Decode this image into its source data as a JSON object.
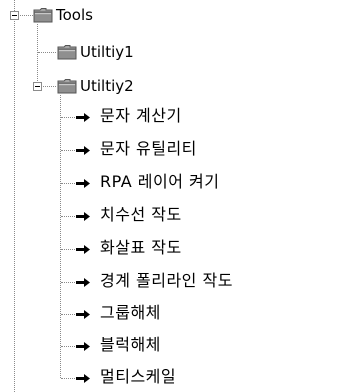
{
  "tree": {
    "root": {
      "label": "Tools",
      "icon": "folder-icon",
      "expanded": true,
      "children": [
        {
          "label": "Utiltiy1",
          "icon": "folder-icon",
          "expanded": false
        },
        {
          "label": "Utiltiy2",
          "icon": "folder-icon",
          "expanded": true,
          "items": [
            {
              "label": "문자 계산기",
              "icon": "arrow-right-icon"
            },
            {
              "label": "문자 유틸리티",
              "icon": "arrow-right-icon"
            },
            {
              "label": "RPA 레이어 켜기",
              "icon": "arrow-right-icon"
            },
            {
              "label": "치수선 작도",
              "icon": "arrow-right-icon"
            },
            {
              "label": "화살표 작도",
              "icon": "arrow-right-icon"
            },
            {
              "label": "경계 폴리라인 작도",
              "icon": "arrow-right-icon"
            },
            {
              "label": "그룹해체",
              "icon": "arrow-right-icon"
            },
            {
              "label": "블럭해체",
              "icon": "arrow-right-icon"
            },
            {
              "label": "멀티스케일",
              "icon": "arrow-right-icon"
            }
          ]
        }
      ]
    }
  },
  "colors": {
    "background": "#ffffff",
    "tree_line": "#8a8a8a",
    "folder_body": "#8f8f8f",
    "folder_tab": "#a6a6a6",
    "arrow": "#000000"
  }
}
